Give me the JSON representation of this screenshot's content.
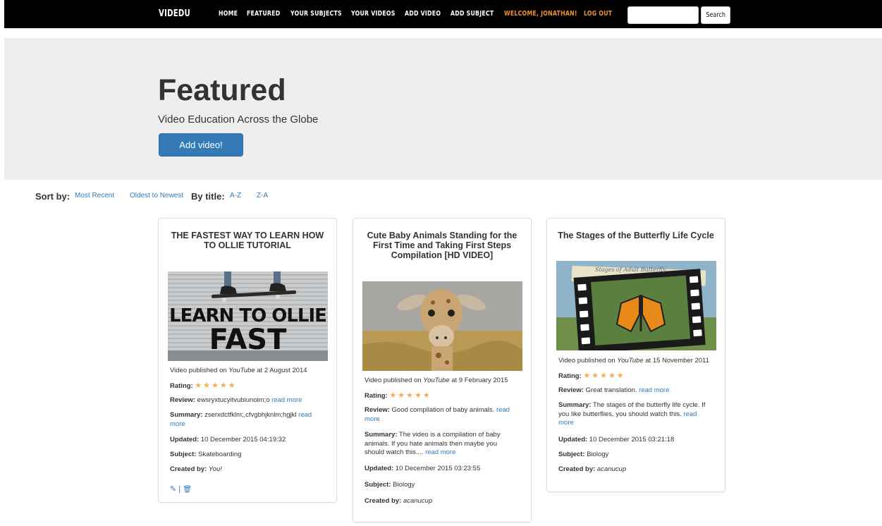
{
  "nav": {
    "brand": "VIDEDU",
    "links": [
      "HOME",
      "FEATURED",
      "YOUR SUBJECTS",
      "YOUR VIDEOS",
      "ADD VIDEO",
      "ADD SUBJECT",
      "WELCOME, JONATHAN!",
      "LOG OUT"
    ],
    "search_placeholder": "",
    "search_button": "Search"
  },
  "colors": {
    "navbar": "#000000",
    "accent_orange": "#f0922e",
    "link_blue": "#337ab7",
    "jumbotron": "#eeeeee",
    "star": "#f0ad4e"
  },
  "jumbotron": {
    "title": "Featured",
    "subtitle": "Video Education Across the Globe",
    "button": "Add video!"
  },
  "sort": {
    "label": "Sort by:",
    "most_recent": "Most Recent",
    "oldest": "Oldest to Newest",
    "by_title": "By title:",
    "az": "A-Z",
    "za": "Z-A"
  },
  "videos": [
    {
      "title_line1": "THE FASTEST WAY TO LEARN HOW",
      "title_line2": "TO OLLIE TUTORIAL",
      "thumb_text1": "LEARN TO OLLIE",
      "thumb_text2": "FAST",
      "published_pre": "Video published on ",
      "platform": "YouTube",
      "published_post": " at 2 August 2014",
      "rating_label": "Rating:",
      "rating": "★★★★★",
      "review_label": "Review:",
      "review": " ewsryxtucyitvubiunoim;o ",
      "read_more": "read more",
      "summary_label": "Summary:",
      "summary": " zserxdctfklm;,cfvgbhjknlm;hgjkl ",
      "summary_line2": "more",
      "updated_label": "Updated:",
      "updated": " 10 December 2015 04:19:32",
      "subject_label": "Subject:",
      "subject": " Skateboarding",
      "created_label": "Created by:",
      "created_by": "You!",
      "edit_icon": "✎",
      "separator": "|",
      "delete_icon": "🗑"
    },
    {
      "title_line1": "Cute Baby Animals Standing for the",
      "title_line2": "First Time and Taking First Steps",
      "title_line3": "Compilation [HD VIDEO]",
      "published_pre": "Video published on ",
      "platform": "YouTube",
      "published_post": " at 9 February 2015",
      "rating_label": "Rating:",
      "rating": "★★★★★",
      "review_label": "Review:",
      "review": " Good compilation of baby animals. ",
      "read_more": "read",
      "review_line2": "more",
      "summary_label": "Summary:",
      "summary": " The video is a compilation of baby",
      "summary_line2": "animals. If you hate animals then maybe you",
      "summary_line3": "should watch this.... ",
      "summary_read_more": "read more",
      "updated_label": "Updated:",
      "updated": " 10 December 2015 03:23:55",
      "subject_label": "Subject:",
      "subject": " Biology",
      "created_label": "Created by:",
      "created_by": "acanucup"
    },
    {
      "title_line1": "The Stages of the Butterfly Life Cycle",
      "thumb_text": "Stages of Adult Butterfly",
      "published_pre": "Video published on ",
      "platform": "YouTube",
      "published_post": " at 15 November 2011",
      "rating_label": "Rating:",
      "rating": "★★★★★",
      "review_label": "Review:",
      "review": " Great translation. ",
      "read_more": "read more",
      "summary_label": "Summary:",
      "summary": " The stages of the butterfly life cycle. If",
      "summary_line2": "you like butterflies, you should watch this. ",
      "summary_read_more": "read",
      "summary_line3": "more",
      "updated_label": "Updated:",
      "updated": " 10 December 2015 03:21:18",
      "subject_label": "Subject:",
      "subject": " Biology",
      "created_label": "Created by:",
      "created_by": "acanucup"
    }
  ]
}
